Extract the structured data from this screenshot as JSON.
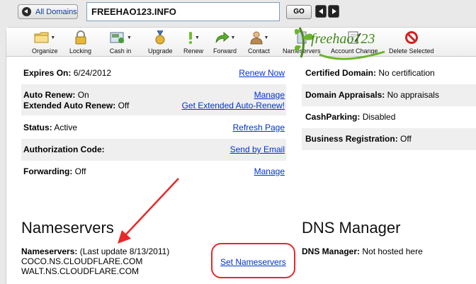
{
  "topbar": {
    "all_domains_label": "All Domains",
    "domain_value": "FREEHAO123.INFO",
    "go_label": "GO"
  },
  "toolbar": {
    "items": [
      {
        "label": "Organize",
        "icon": "folder-icon"
      },
      {
        "label": "Locking",
        "icon": "lock-icon"
      },
      {
        "label": "Cash in",
        "icon": "cash-register-icon"
      },
      {
        "label": "Upgrade",
        "icon": "medal-icon"
      },
      {
        "label": "Renew",
        "icon": "exclamation-icon"
      },
      {
        "label": "Forward",
        "icon": "forward-arrow-icon"
      },
      {
        "label": "Contact",
        "icon": "person-icon"
      },
      {
        "label": "Nameservers",
        "icon": "server-icon"
      },
      {
        "label": "Account Change",
        "icon": "edit-document-icon"
      },
      {
        "label": "Delete Selected",
        "icon": "prohibited-icon"
      }
    ]
  },
  "watermark": {
    "text": "freehao123"
  },
  "left_rows": {
    "expires_label": "Expires On:",
    "expires_value": "6/24/2012",
    "expires_action": "Renew Now",
    "auto_renew_label": "Auto Renew:",
    "auto_renew_value": "On",
    "auto_renew_action": "Manage",
    "ext_auto_renew_label": "Extended Auto Renew:",
    "ext_auto_renew_value": "Off",
    "ext_auto_renew_action": "Get Extended Auto-Renew!",
    "status_label": "Status:",
    "status_value": "Active",
    "status_action": "Refresh Page",
    "auth_label": "Authorization Code:",
    "auth_action": "Send by Email",
    "forwarding_label": "Forwarding:",
    "forwarding_value": "Off",
    "forwarding_action": "Manage"
  },
  "right_rows": {
    "certified_label": "Certified Domain:",
    "certified_value": "No certification",
    "appraisals_label": "Domain Appraisals:",
    "appraisals_value": "No appraisals",
    "cashparking_label": "CashParking:",
    "cashparking_value": "Disabled",
    "business_label": "Business Registration:",
    "business_value": "Off"
  },
  "nameservers": {
    "heading": "Nameservers",
    "label": "Nameservers:",
    "last_update": "(Last update 8/13/2011)",
    "ns1": "COCO.NS.CLOUDFLARE.COM",
    "ns2": "WALT.NS.CLOUDFLARE.COM",
    "action": "Set Nameservers"
  },
  "dns": {
    "heading": "DNS Manager",
    "label": "DNS Manager:",
    "value": "Not hosted here"
  },
  "colors": {
    "link": "#0033cc",
    "highlight": "#e8282a",
    "row_alt": "#efefef"
  }
}
